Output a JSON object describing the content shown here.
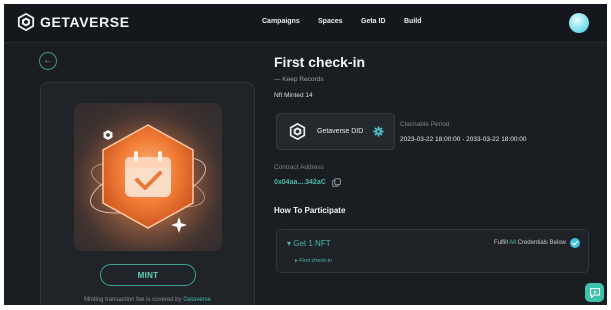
{
  "brand": {
    "name": "GETAVERSE"
  },
  "nav": [
    "Campaigns",
    "Spaces",
    "Geta ID",
    "Build"
  ],
  "page": {
    "title": "First check-in",
    "subtitle": "— Keep Records",
    "minted": "Nft Minted 14"
  },
  "did": {
    "label": "Getaverse DID",
    "icon": "getaverse-logo-icon",
    "badge_icon": "badge-gear-icon"
  },
  "claim": {
    "label": "Claimable Period",
    "value": "2023-03-22 18:00:00 - 2033-03-22 18:00:00"
  },
  "contract": {
    "label": "Contract Address",
    "value": "0x04aa....342aC",
    "copy_icon": "copy-icon"
  },
  "participate": {
    "title": "How To Participate",
    "task": "Get 1 NFT",
    "fulfill_prefix": "Fulfill ",
    "fulfill_highlight": "All",
    "fulfill_suffix": " Credentials Below",
    "subtask": "First check-in"
  },
  "nft_card": {
    "mint_label": "MINT",
    "note_prefix": "Minting transaction fee is covered by ",
    "note_link": "Getaverse"
  },
  "colors": {
    "accent": "#4ab9a6",
    "background": "#1a1e23",
    "header": "#14171b",
    "nft_orange": "#e96f2c"
  }
}
